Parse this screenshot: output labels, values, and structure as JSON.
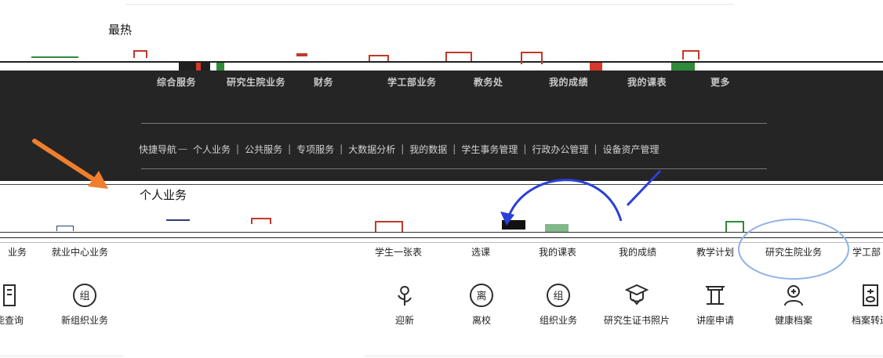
{
  "sections": {
    "hot_title": "最热",
    "personal_title": "个人业务"
  },
  "top_band": {
    "labels": [
      "综合服务",
      "研究生院业务",
      "财务",
      "学工部业务",
      "教务处",
      "我的成绩",
      "我的课表",
      "更多"
    ]
  },
  "nav": {
    "items": [
      "快捷导航",
      "个人业务",
      "公共服务",
      "专项服务",
      "大数据分析",
      "我的数据",
      "学生事务管理",
      "行政办公管理",
      "设备资产管理"
    ]
  },
  "business_row": {
    "left_items": [
      "业务",
      "就业中心业务"
    ],
    "right_items": [
      "学生一张表",
      "选课",
      "我的课表",
      "我的成绩",
      "教学计划",
      "研究生院业务",
      "学工部"
    ]
  },
  "services": {
    "left_items": [
      {
        "label": "能查询",
        "icon": "search-doc-icon"
      },
      {
        "label": "新组织业务",
        "icon": "org-icon"
      }
    ],
    "right_items": [
      {
        "label": "迎新",
        "icon": "flower-icon"
      },
      {
        "label": "离校",
        "icon": "leave-school-icon"
      },
      {
        "label": "组织业务",
        "icon": "org-icon"
      },
      {
        "label": "研究生证书照片",
        "icon": "graduate-cap-icon"
      },
      {
        "label": "讲座申请",
        "icon": "lecture-icon"
      },
      {
        "label": "健康档案",
        "icon": "health-icon"
      },
      {
        "label": "档案转送",
        "icon": "archive-icon"
      }
    ]
  },
  "colors": {
    "band": "#252525",
    "arrow_orange": "#f07f2d",
    "arrow_blue": "#2a3fd8",
    "circle_blue": "#8fb3e8",
    "icon": "#2c2c2c"
  }
}
